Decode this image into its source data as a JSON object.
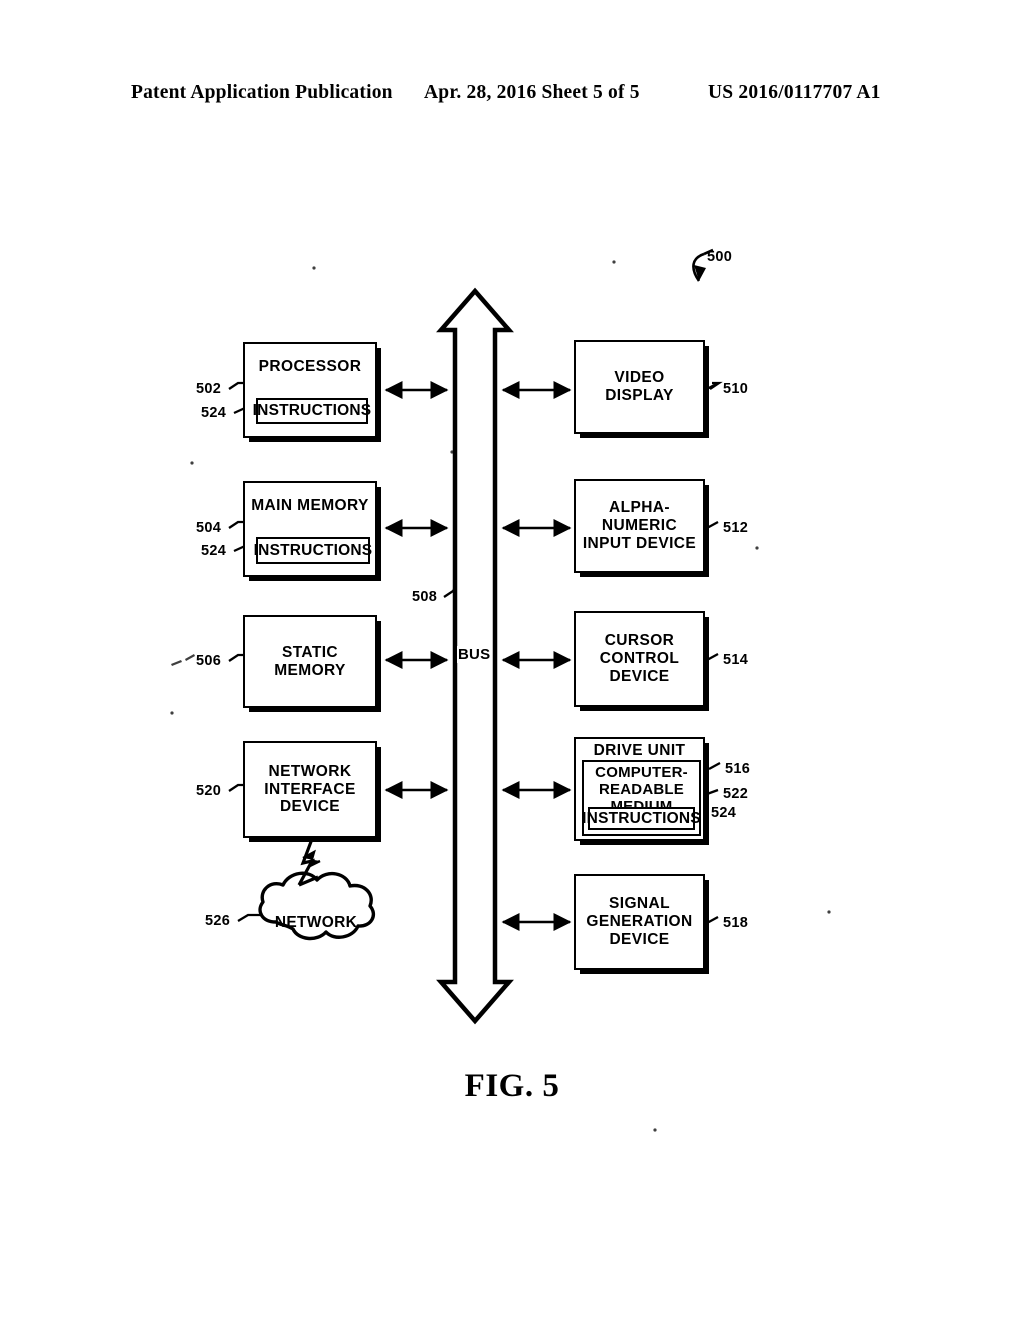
{
  "header": {
    "left": "Patent Application Publication",
    "middle": "Apr. 28, 2016  Sheet 5 of 5",
    "right": "US 2016/0117707 A1"
  },
  "figure": {
    "caption": "FIG. 5",
    "system_ref": "500",
    "bus_label": "BUS",
    "bus_ref": "508"
  },
  "blocks": {
    "processor": {
      "label": "PROCESSOR",
      "ref": "502",
      "inner_label": "INSTRUCTIONS",
      "inner_ref": "524"
    },
    "main_memory": {
      "label": "MAIN MEMORY",
      "ref": "504",
      "inner_label": "INSTRUCTIONS",
      "inner_ref": "524"
    },
    "static_memory": {
      "label": "STATIC\nMEMORY",
      "ref": "506"
    },
    "network_interface": {
      "label": "NETWORK\nINTERFACE\nDEVICE",
      "ref": "520"
    },
    "network_cloud": {
      "label": "NETWORK",
      "ref": "526"
    },
    "video_display": {
      "label": "VIDEO\nDISPLAY",
      "ref": "510"
    },
    "alpha_numeric_input": {
      "label": "ALPHA-NUMERIC\nINPUT DEVICE",
      "ref": "512"
    },
    "cursor_control": {
      "label": "CURSOR\nCONTROL\nDEVICE",
      "ref": "514"
    },
    "drive_unit": {
      "label": "DRIVE UNIT",
      "ref": "516",
      "medium_label": "COMPUTER-\nREADABLE\nMEDIUM",
      "medium_ref": "522",
      "instructions_label": "INSTRUCTIONS",
      "instructions_ref": "524"
    },
    "signal_generation": {
      "label": "SIGNAL\nGENERATION\nDEVICE",
      "ref": "518"
    }
  },
  "colors": {
    "ink": "#000000",
    "paper": "#ffffff"
  }
}
